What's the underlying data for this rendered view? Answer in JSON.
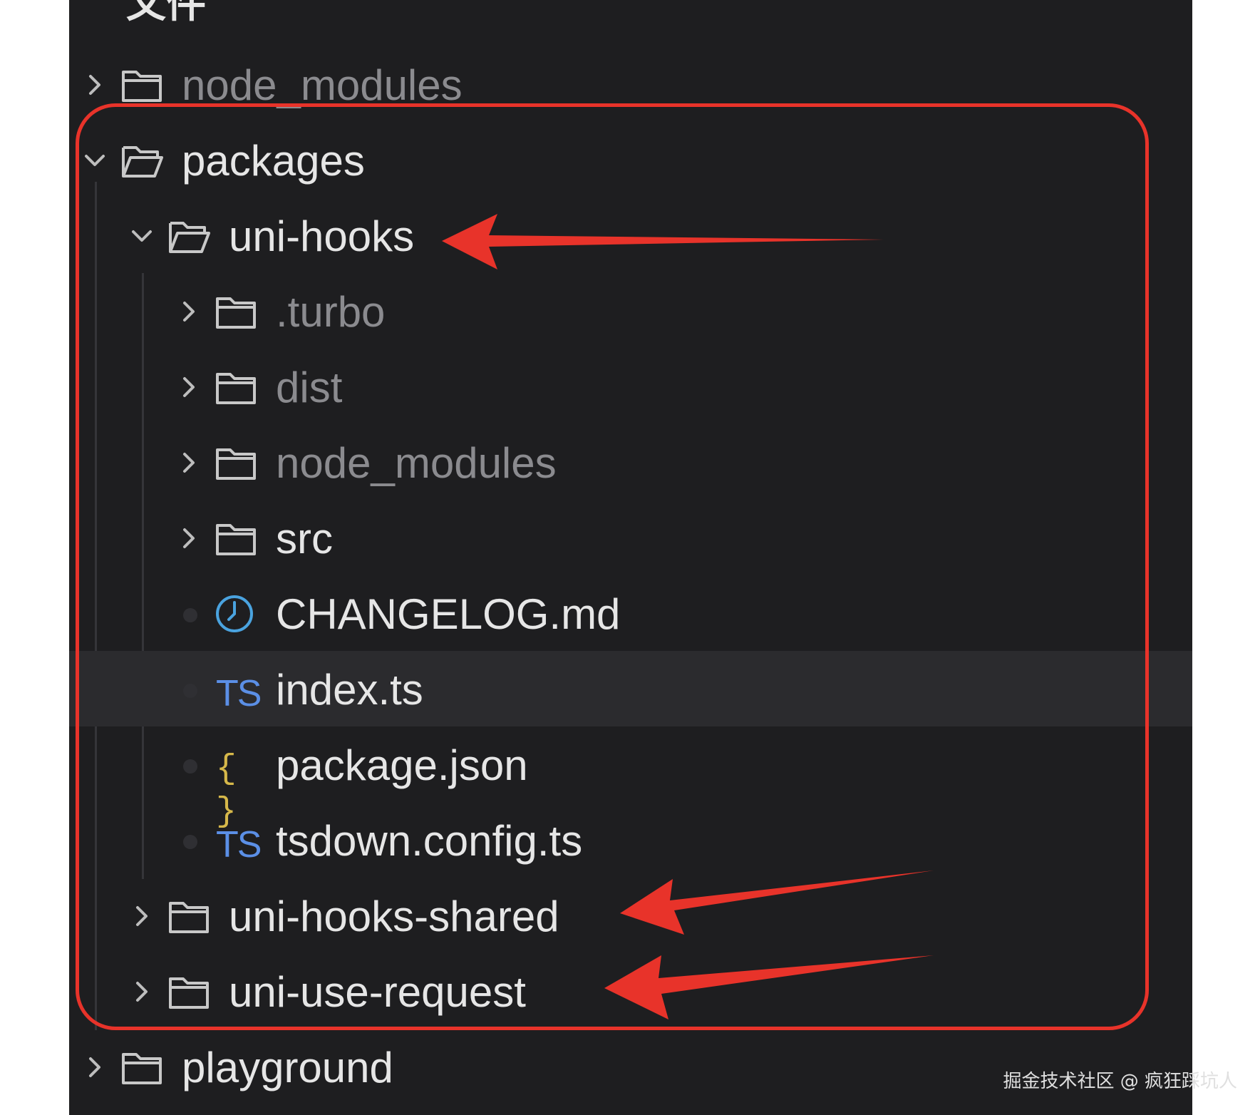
{
  "explorer": {
    "section_title": "文件",
    "rows": [
      {
        "label": "node_modules",
        "kind": "folder",
        "expanded": false,
        "dim": true,
        "depth": 0
      },
      {
        "label": "packages",
        "kind": "folder",
        "expanded": true,
        "dim": false,
        "depth": 0
      },
      {
        "label": "uni-hooks",
        "kind": "folder",
        "expanded": true,
        "dim": false,
        "depth": 1
      },
      {
        "label": ".turbo",
        "kind": "folder",
        "expanded": false,
        "dim": true,
        "depth": 2
      },
      {
        "label": "dist",
        "kind": "folder",
        "expanded": false,
        "dim": true,
        "depth": 2
      },
      {
        "label": "node_modules",
        "kind": "folder",
        "expanded": false,
        "dim": true,
        "depth": 2
      },
      {
        "label": "src",
        "kind": "folder",
        "expanded": false,
        "dim": false,
        "depth": 2
      },
      {
        "label": "CHANGELOG.md",
        "kind": "changelog-file",
        "dim": false,
        "depth": 2
      },
      {
        "label": "index.ts",
        "kind": "ts-file",
        "dim": false,
        "depth": 2,
        "selected": true
      },
      {
        "label": "package.json",
        "kind": "json-file",
        "dim": false,
        "depth": 2
      },
      {
        "label": "tsdown.config.ts",
        "kind": "ts-file",
        "dim": false,
        "depth": 2
      },
      {
        "label": "uni-hooks-shared",
        "kind": "folder",
        "expanded": false,
        "dim": false,
        "depth": 1
      },
      {
        "label": "uni-use-request",
        "kind": "folder",
        "expanded": false,
        "dim": false,
        "depth": 1
      },
      {
        "label": "playground",
        "kind": "folder",
        "expanded": false,
        "dim": false,
        "depth": 0
      }
    ],
    "ts_icon_text": "TS",
    "json_icon_text": "{ }"
  },
  "annotation": {
    "box_color": "#e8332a",
    "arrow_color": "#e8332a",
    "arrow_targets": [
      "uni-hooks",
      "uni-hooks-shared",
      "uni-use-request"
    ]
  },
  "watermark": "掘金技术社区 @ 疯狂踩坑人",
  "colors": {
    "background": "#1e1e20",
    "text": "#e6e6e6",
    "dim_text": "#8b8b8f",
    "selected_row": "#2b2b2e",
    "ts_icon": "#5b8fe6",
    "json_icon": "#d6b84a",
    "changelog_icon": "#4aa3df"
  }
}
